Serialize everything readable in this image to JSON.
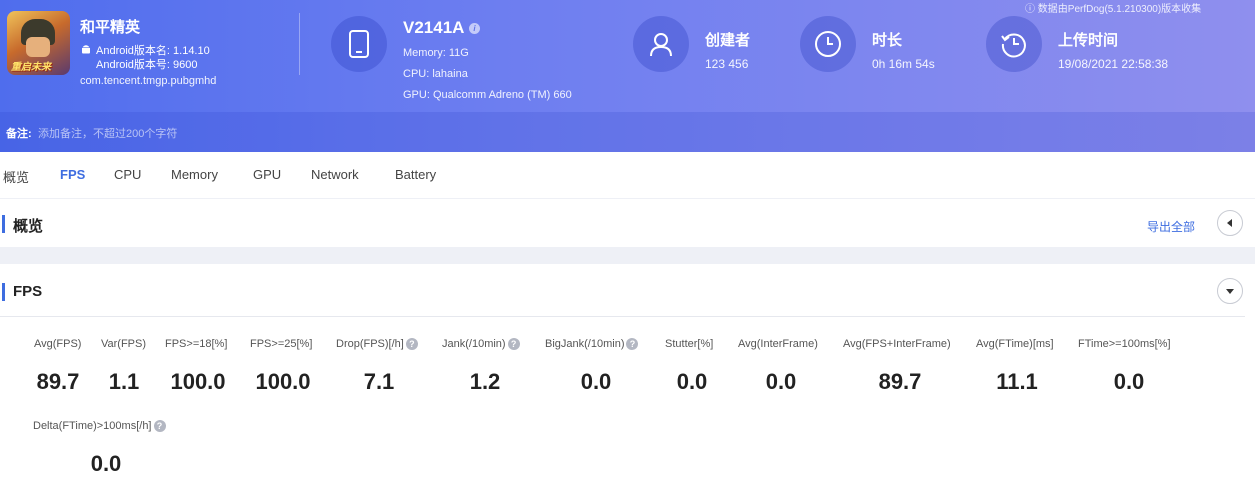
{
  "header": {
    "app": {
      "name": "和平精英",
      "version_name": "Android版本名: 1.14.10",
      "version_code": "Android版本号: 9600",
      "package": "com.tencent.tmgp.pubgmhd",
      "icon_text": "重启未来"
    },
    "device": {
      "model": "V2141A",
      "memory": "Memory: 11G",
      "cpu": "CPU: lahaina",
      "gpu": "GPU: Qualcomm Adreno (TM) 660"
    },
    "creator": {
      "title": "创建者",
      "value": "123 456"
    },
    "duration": {
      "title": "时长",
      "value": "0h 16m 54s"
    },
    "upload": {
      "title": "上传时间",
      "value": "19/08/2021 22:58:38"
    },
    "source_note": "ⓘ 数据由PerfDog(5.1.210300)版本收集",
    "note_label": "备注:",
    "note_placeholder": "添加备注，不超过200个字符"
  },
  "tabs": [
    "概览",
    "FPS",
    "CPU",
    "Memory",
    "GPU",
    "Network",
    "Battery"
  ],
  "active_tab": "FPS",
  "overview": {
    "title": "概览",
    "export_label": "导出全部"
  },
  "fps": {
    "title": "FPS",
    "metrics": [
      {
        "label": "Avg(FPS)",
        "value": "89.7"
      },
      {
        "label": "Var(FPS)",
        "value": "1.1"
      },
      {
        "label": "FPS>=18[%]",
        "value": "100.0"
      },
      {
        "label": "FPS>=25[%]",
        "value": "100.0"
      },
      {
        "label": "Drop(FPS)[/h]",
        "value": "7.1"
      },
      {
        "label": "Jank(/10min)",
        "value": "1.2"
      },
      {
        "label": "BigJank(/10min)",
        "value": "0.0"
      },
      {
        "label": "Stutter[%]",
        "value": "0.0"
      },
      {
        "label": "Avg(InterFrame)",
        "value": "0.0"
      },
      {
        "label": "Avg(FPS+InterFrame)",
        "value": "89.7"
      },
      {
        "label": "Avg(FTime)[ms]",
        "value": "11.1"
      },
      {
        "label": "FTime>=100ms[%]",
        "value": "0.0"
      },
      {
        "label": "Delta(FTime)>100ms[/h]",
        "value": "0.0"
      }
    ]
  },
  "colors": {
    "accent": "#3e6de0",
    "header_start": "#4f6ded",
    "header_end": "#8f8fee"
  }
}
